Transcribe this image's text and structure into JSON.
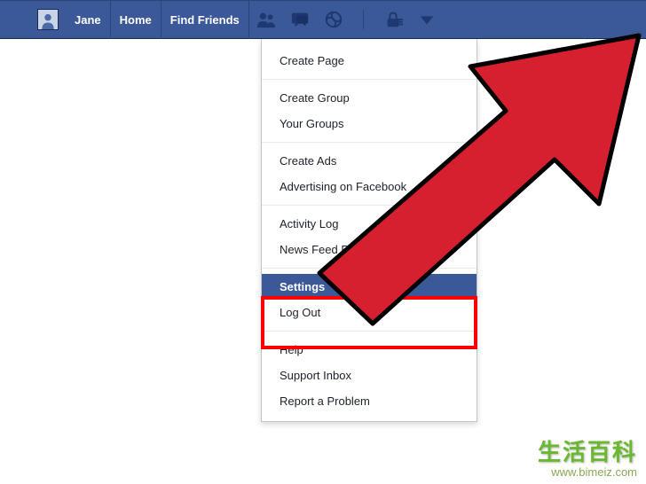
{
  "topbar": {
    "user_name": "Jane",
    "home_label": "Home",
    "find_friends_label": "Find Friends"
  },
  "dropdown": {
    "groups": [
      [
        {
          "label": "Create Page",
          "key": "create-page"
        }
      ],
      [
        {
          "label": "Create Group",
          "key": "create-group"
        },
        {
          "label": "Your Groups",
          "key": "your-groups"
        }
      ],
      [
        {
          "label": "Create Ads",
          "key": "create-ads"
        },
        {
          "label": "Advertising on Facebook",
          "key": "advertising-on-fb"
        }
      ],
      [
        {
          "label": "Activity Log",
          "key": "activity-log"
        },
        {
          "label": "News Feed Preferences",
          "key": "news-feed-prefs"
        }
      ],
      [
        {
          "label": "Settings",
          "key": "settings",
          "selected": true
        },
        {
          "label": "Log Out",
          "key": "log-out"
        }
      ],
      [
        {
          "label": "Help",
          "key": "help"
        },
        {
          "label": "Support Inbox",
          "key": "support-inbox"
        },
        {
          "label": "Report a Problem",
          "key": "report-problem"
        }
      ]
    ]
  },
  "watermark": {
    "cn": "生活百科",
    "url": "www.bimeiz.com"
  },
  "colors": {
    "fb_blue": "#3b5998",
    "highlight_red": "#ff0000",
    "arrow_red": "#d62030"
  }
}
